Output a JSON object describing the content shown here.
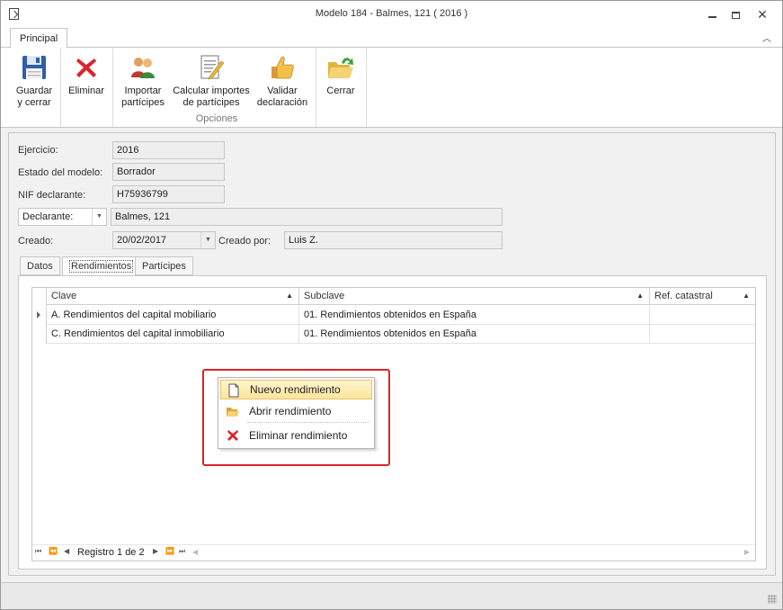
{
  "window": {
    "title": "Modelo 184 - Balmes, 121 ( 2016 )"
  },
  "ribbon": {
    "tab": "Principal",
    "buttons": {
      "save": "Guardar\ny cerrar",
      "delete": "Eliminar",
      "import": "Importar\npartícipes",
      "calc": "Calcular importes\nde partícipes",
      "validate": "Validar\ndeclaración",
      "close": "Cerrar"
    },
    "group_label": "Opciones"
  },
  "form": {
    "ejercicio_label": "Ejercicio:",
    "ejercicio_value": "2016",
    "estado_label": "Estado del modelo:",
    "estado_value": "Borrador",
    "nif_label": "NIF declarante:",
    "nif_value": "H75936799",
    "declarante_combo": "Declarante:",
    "declarante_value": "Balmes, 121",
    "creado_label": "Creado:",
    "creado_value": "20/02/2017",
    "creado_por_label": "Creado por:",
    "creado_por_value": "Luis Z."
  },
  "tabs": [
    "Datos",
    "Rendimientos",
    "Partícipes"
  ],
  "grid": {
    "columns": [
      "Clave",
      "Subclave",
      "Ref. catastral"
    ],
    "rows": [
      [
        "A. Rendimientos del capital mobiliario",
        "01. Rendimientos obtenidos en España",
        ""
      ],
      [
        "C. Rendimientos del capital inmobiliario",
        "01. Rendimientos obtenidos en España",
        ""
      ]
    ],
    "navigator": "Registro 1 de 2"
  },
  "context_menu": {
    "items": [
      "Nuevo rendimiento",
      "Abrir rendimiento",
      "Eliminar rendimiento"
    ]
  },
  "colors": {
    "highlight": "#d9242b",
    "menu_hover": "#fde59a"
  }
}
